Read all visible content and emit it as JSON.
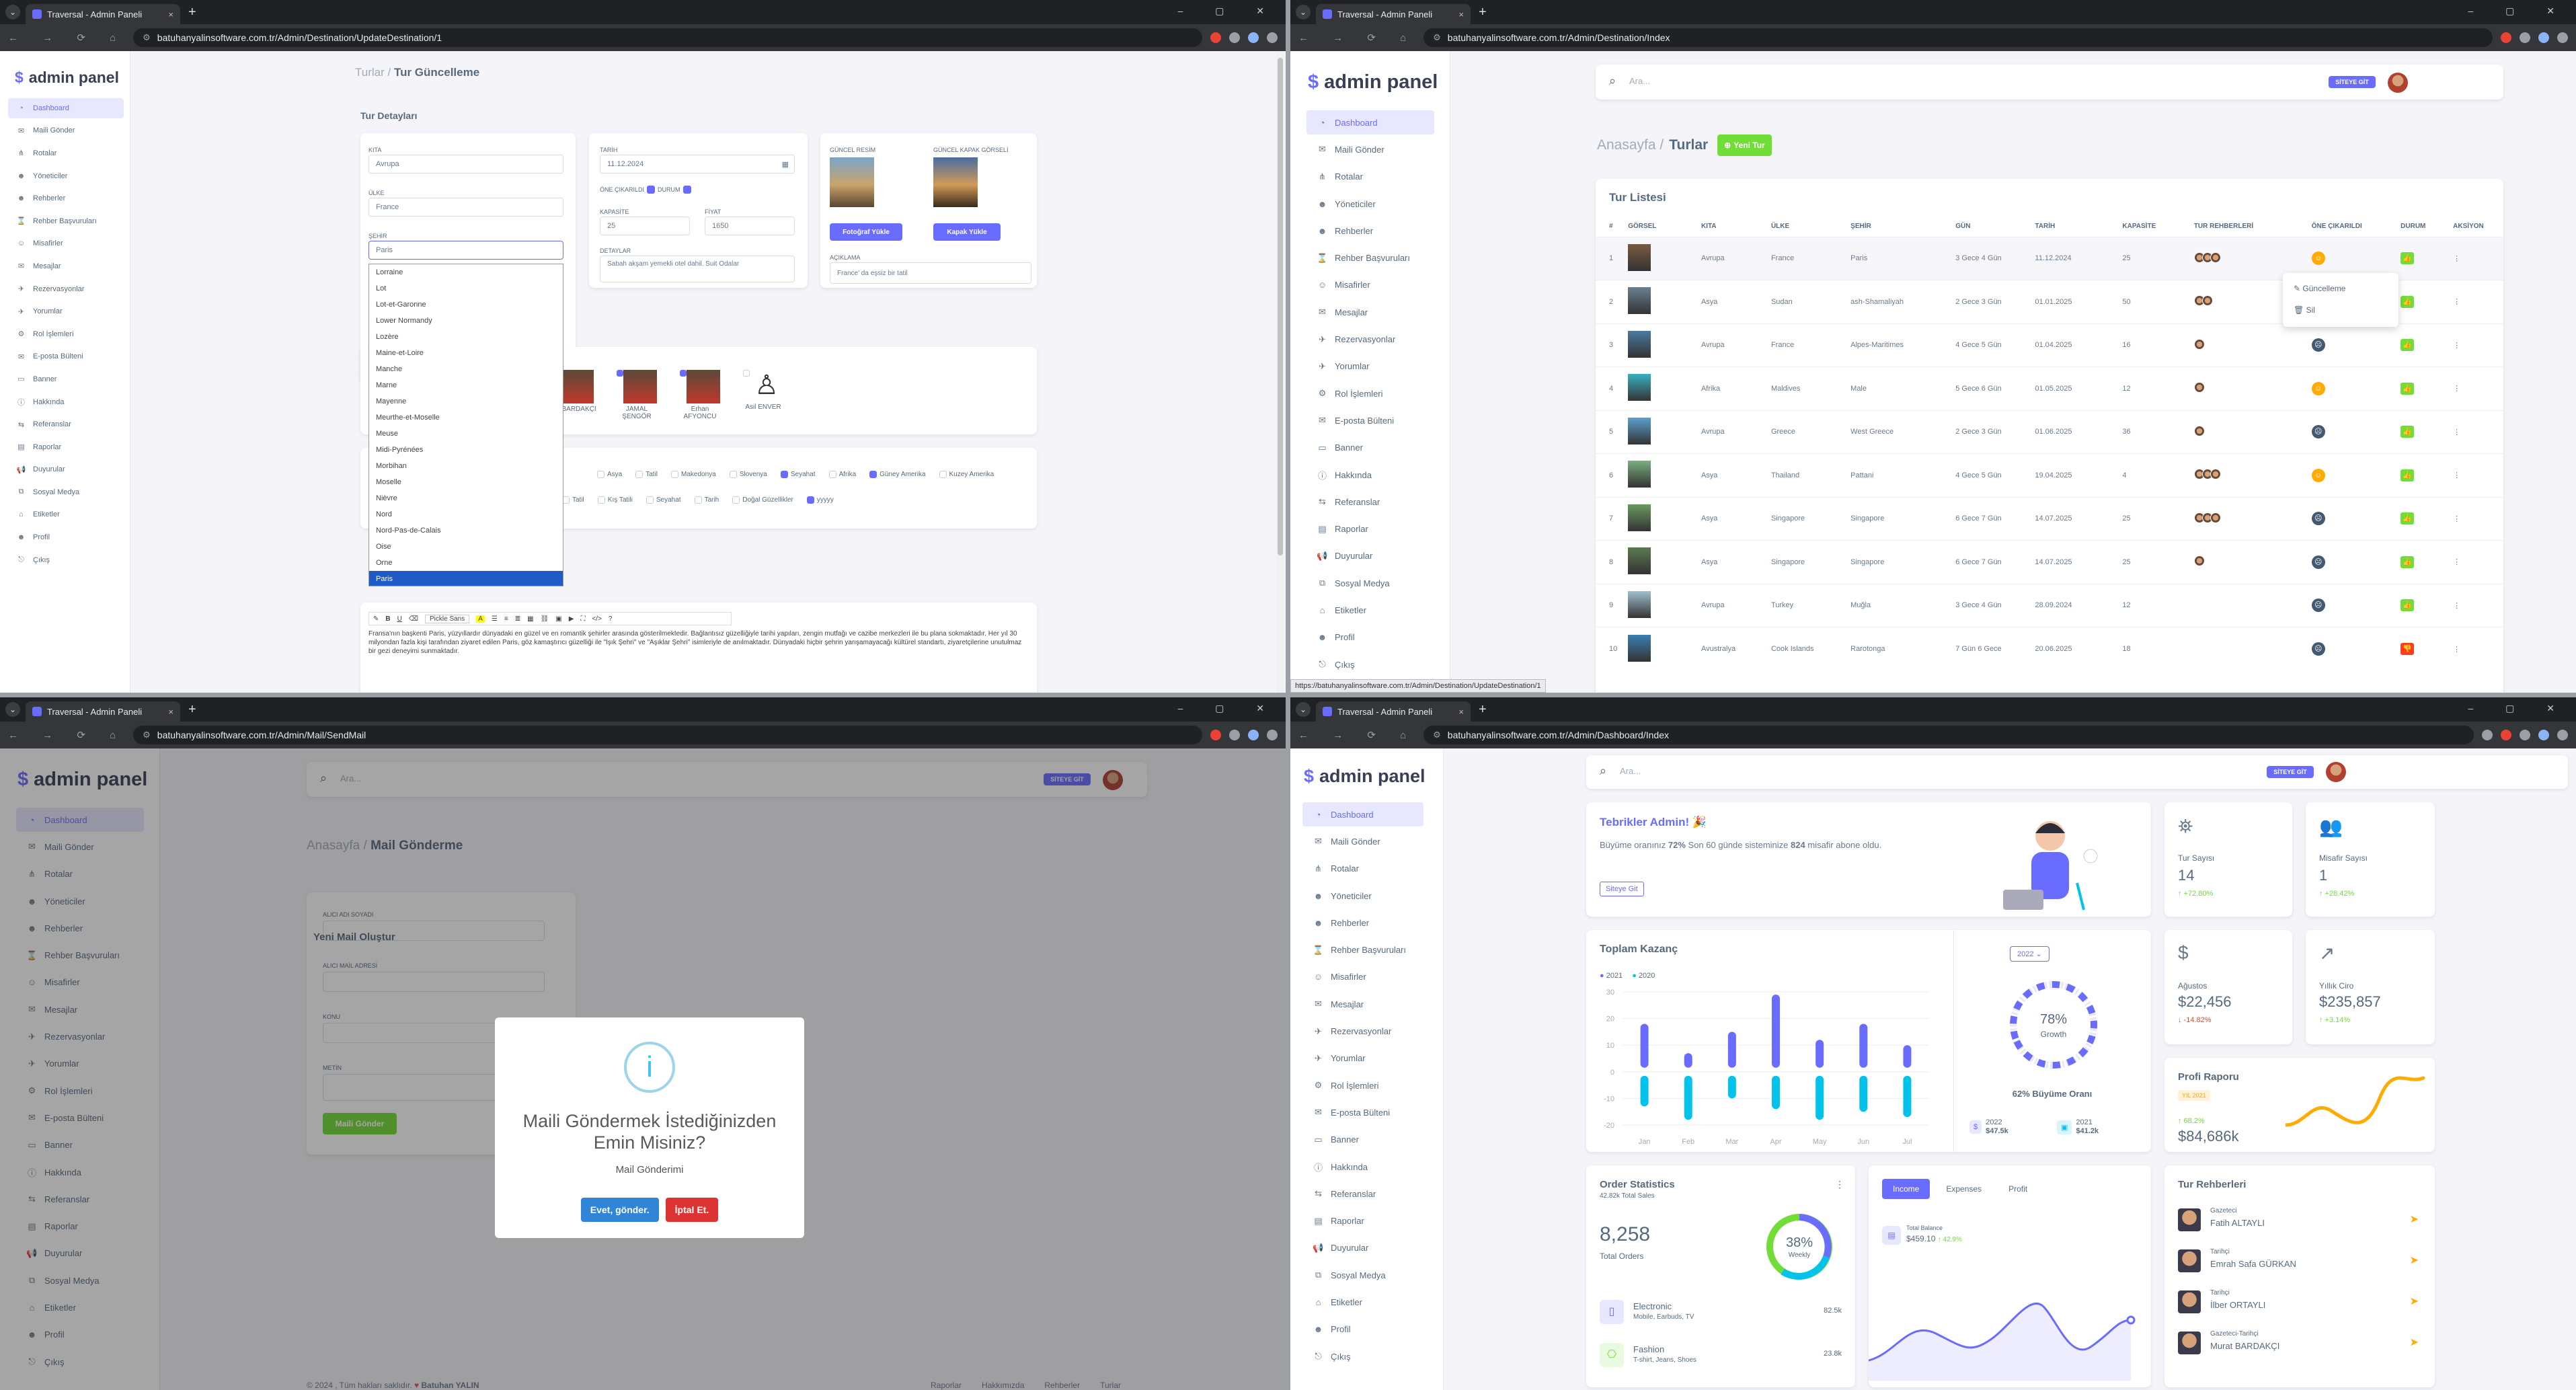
{
  "browser": {
    "tab_title": "Traversal - Admin Paneli",
    "close": "×",
    "new_tab": "+",
    "dropdown": "⌄",
    "controls": "– ▢ ✕",
    "nav": "← → ⟳ ⌂"
  },
  "brand": "admin panel",
  "menu": [
    "Dashboard",
    "Maili Gönder",
    "Rotalar",
    "Yöneticiler",
    "Rehberler",
    "Rehber Başvuruları",
    "Misafirler",
    "Mesajlar",
    "Rezervasyonlar",
    "Yorumlar",
    "Rol İşlemleri",
    "E-posta Bülteni",
    "Banner",
    "Hakkında",
    "Referanslar",
    "Raporlar",
    "Duyurular",
    "Sosyal Medya",
    "Etiketler",
    "Profil",
    "Çıkış"
  ],
  "menu_icons": [
    "◔",
    "✉",
    "⋔",
    "☻",
    "☻",
    "⌛",
    "☺",
    "✉",
    "✈",
    "✈",
    "⚙",
    "✉",
    "▭",
    "ⓘ",
    "⇆",
    "▤",
    "📢",
    "⧉",
    "⌂",
    "☻",
    "⎋"
  ],
  "search_placeholder": "Ara...",
  "site_button": "SİTEYE GİT",
  "w1": {
    "url": "batuhanyalinsoftware.com.tr/Admin/Destination/UpdateDestination/1",
    "breadcrumb_root": "Turlar /",
    "breadcrumb_current": "Tur Güncelleme",
    "section_title": "Tur Detayları",
    "kita_label": "KITA",
    "kita": "Avrupa",
    "ulke_label": "ÜLKE",
    "ulke": "France",
    "sehir_label": "ŞEHİR",
    "sehir": "Paris",
    "tarih_label": "TARİH",
    "tarih": "11.12.2024",
    "one_cikarildi": "ÖNE ÇIKARILDI",
    "durum": "DURUM",
    "kapasite_label": "KAPASİTE",
    "kapasite": "25",
    "fiyat_label": "FİYAT",
    "fiyat": "1650",
    "detaylar_label": "DETAYLAR",
    "detaylar": "Sabah akşam yemekli otel dahil. Suit Odalar",
    "guncel_resim": "GÜNCEL RESİM",
    "kapak_resim": "GÜNCEL KAPAK GÖRSELİ",
    "foto_btn": "Fotoğraf Yükle",
    "kapak_btn": "Kapak Yükle",
    "aciklama_label": "AÇIKLAMA",
    "aciklama": "France' da eşsiz bir tatil",
    "dropdown": [
      "Lorraine",
      "Lot",
      "Lot-et-Garonne",
      "Lower Normandy",
      "Lozère",
      "Maine-et-Loire",
      "Manche",
      "Marne",
      "Mayenne",
      "Meurthe-et-Moselle",
      "Meuse",
      "Midi-Pyrénées",
      "Morbihan",
      "Moselle",
      "Nièvre",
      "Nord",
      "Nord-Pas-de-Calais",
      "Oise",
      "Orne",
      "Paris"
    ],
    "guides": [
      {
        "name": "cat BARDAKÇI"
      },
      {
        "name": "JAMAL ŞENGÖR"
      },
      {
        "name": "Erhan AFYONCU"
      },
      {
        "name": "Asil ENVER"
      }
    ],
    "tags1": [
      "Asya",
      "Tatil",
      "Makedonya",
      "Slovenya",
      "Seyahat",
      "Afrika",
      "Güney Amerika",
      "Kuzey Amerika"
    ],
    "tags2": [
      "Tatil",
      "Kış Tatili",
      "Seyahat",
      "Tarih",
      "Doğal Güzellikler",
      "yyyyy"
    ],
    "editor_font": "Pickle Sans",
    "editor_text": "Fransa'nın başkenti Paris, yüzyıllardır dünyadaki en güzel ve en romantik şehirler arasında gösterilmektedir. Bağlantısız güzelliğiyle tarihi yapıları, zengin mutfağı ve cazibe merkezleri ile bu plana sokmaktadır. Her yıl 30 milyondan fazla kişi tarafından ziyaret edilen Paris, göz kamaştırıcı güzelliği ile \"Işık Şehri\" ve \"Aşıklar Şehri\" isimleriyle de anılmaktadır. Dünyadaki hiçbir şehrin yarışamayacağı kültürel standartı, ziyaretçilerine unutulmaz bir gezi deneyimi sunmaktadır."
  },
  "w2": {
    "url": "batuhanyalinsoftware.com.tr/Admin/Destination/Index",
    "breadcrumb_root": "Anasayfa /",
    "breadcrumb_current": "Turlar",
    "new_btn": "Yeni Tur",
    "list_title": "Tur Listesi",
    "headers": [
      "#",
      "GÖRSEL",
      "KITA",
      "ÜLKE",
      "ŞEHİR",
      "GÜN",
      "TARİH",
      "KAPASİTE",
      "TUR REHBERLERİ",
      "ÖNE ÇIKARILDI",
      "DURUM",
      "AKSİYON"
    ],
    "rows": [
      [
        "1",
        "Avrupa",
        "France",
        "Paris",
        "3 Gece 4 Gün",
        "11.12.2024",
        "25",
        "3",
        "y",
        "on"
      ],
      [
        "2",
        "Asya",
        "Sudan",
        "ash-Shamaliyah",
        "2 Gece 3 Gün",
        "01.01.2025",
        "50",
        "2",
        "y",
        "on"
      ],
      [
        "3",
        "Avrupa",
        "France",
        "Alpes-Maritimes",
        "4 Gece 5 Gün",
        "01.04.2025",
        "16",
        "1",
        "n",
        "on"
      ],
      [
        "4",
        "Afrika",
        "Maldives",
        "Male",
        "5 Gece 6 Gün",
        "01.05.2025",
        "12",
        "1",
        "y",
        "on"
      ],
      [
        "5",
        "Avrupa",
        "Greece",
        "West Greece",
        "2 Gece 3 Gün",
        "01.06.2025",
        "36",
        "1",
        "n",
        "on"
      ],
      [
        "6",
        "Asya",
        "Thailand",
        "Pattani",
        "4 Gece 5 Gün",
        "19.04.2025",
        "4",
        "3",
        "y",
        "on"
      ],
      [
        "7",
        "Asya",
        "Singapore",
        "Singapore",
        "6 Gece 7 Gün",
        "14.07.2025",
        "25",
        "3",
        "n",
        "on"
      ],
      [
        "8",
        "Asya",
        "Singapore",
        "Singapore",
        "6 Gece 7 Gün",
        "14.07.2025",
        "25",
        "1",
        "n",
        "on"
      ],
      [
        "9",
        "Avrupa",
        "Turkey",
        "Muğla",
        "3 Gece 4 Gün",
        "28.09.2024",
        "12",
        "0",
        "n",
        "on"
      ],
      [
        "10",
        "Avustralya",
        "Cook Islands",
        "Rarotonga",
        "7 Gün 6 Gece",
        "20.06.2025",
        "18",
        "0",
        "n",
        "off"
      ]
    ],
    "action_update": "Güncelleme",
    "action_delete": "Sil",
    "status_bar": "https://batuhanyalinsoftware.com.tr/Admin/Destination/UpdateDestination/1"
  },
  "w3": {
    "url": "batuhanyalinsoftware.com.tr/Admin/Mail/SendMail",
    "breadcrumb_root": "Anasayfa /",
    "breadcrumb_current": "Mail Gönderme",
    "form_title": "Yeni Mail Oluştur",
    "f1": "ALICI ADI SOYADI",
    "f2": "ALICI MAİL ADRESİ",
    "f3": "KONU",
    "f4": "METİN",
    "send_btn": "Maili Gönder",
    "modal_title": "Maili Göndermek İstediğinizden Emin Misiniz?",
    "modal_text": "Mail Gönderimi",
    "confirm": "Evet, gönder.",
    "cancel": "İptal Et.",
    "footer_left": "© 2024 , Tüm hakları saklıdır.",
    "footer_author": "Batuhan YALIN",
    "footer_links": [
      "Raporlar",
      "Hakkımızda",
      "Rehberler",
      "Turlar"
    ]
  },
  "w4": {
    "url": "batuhanyalinsoftware.com.tr/Admin/Dashboard/Index",
    "congrats": "Tebrikler Admin! 🎉",
    "congrats_text_1": "Büyüme oranınız ",
    "congrats_rate": "72%",
    "congrats_text_2": " Son 60 günde sisteminize ",
    "congrats_count": "824",
    "congrats_text_3": " misafir abone oldu.",
    "site_btn": "Siteye Git",
    "tur_label": "Tur Sayısı",
    "tur_value": "14",
    "tur_delta": "↑ +72.80%",
    "misafir_label": "Misafir Sayısı",
    "misafir_value": "1",
    "misafir_delta": "↑ +28.42%",
    "earn_title": "Toplam Kazanç",
    "legend": [
      "2021",
      "2020"
    ],
    "year_btn": "2022 ⌄",
    "growth_pct": "78%",
    "growth_label": "Growth",
    "growth_caption": "62% Büyüme Oranı",
    "y2022": "2022",
    "v2022": "$47.5k",
    "y2021": "2021",
    "v2021": "$41.2k",
    "agustos_label": "Ağustos",
    "agustos_value": "$22,456",
    "agustos_delta": "↓ -14.82%",
    "yillik_label": "Yıllık Ciro",
    "yillik_value": "$235,857",
    "yillik_delta": "↑ +3.14%",
    "profi_title": "Profi Raporu",
    "profi_year": "YIL 2021",
    "profi_delta": "↑ 68.2%",
    "profi_value": "$84,686k",
    "order_title": "Order Statistics",
    "order_sub": "42.82k Total Sales",
    "order_value": "8,258",
    "order_label": "Total Orders",
    "weekly_pct": "38%",
    "weekly_label": "Weekly",
    "electronic": "Electronic",
    "electronic_sub": "Mobile, Earbuds, TV",
    "electronic_val": "82.5k",
    "fashion": "Fashion",
    "fashion_sub": "T-shirt, Jeans, Shoes",
    "fashion_val": "23.8k",
    "tabs": [
      "Income",
      "Expenses",
      "Profit"
    ],
    "tb_label": "Total Balance",
    "tb_value": "$459.10",
    "tb_delta": "↑ 42.9%",
    "guides_title": "Tur Rehberleri",
    "guides": [
      {
        "role": "Gazeteci",
        "name": "Fatih ALTAYLI"
      },
      {
        "role": "Tarihçi",
        "name": "Emrah Safa GÜRKAN"
      },
      {
        "role": "Tarihçi",
        "name": "İlber ORTAYLI"
      },
      {
        "role": "Gazeteci-Tarihçi",
        "name": "Murat BARDAKÇI"
      }
    ]
  },
  "chart_data": {
    "type": "bar",
    "title": "Toplam Kazanç",
    "categories": [
      "Jan",
      "Feb",
      "Mar",
      "Apr",
      "May",
      "Jun",
      "Jul"
    ],
    "series": [
      {
        "name": "2021",
        "values": [
          18,
          7,
          15,
          29,
          12,
          18,
          10
        ]
      },
      {
        "name": "2020",
        "values": [
          -13,
          -18,
          -10,
          -14,
          -18,
          -15,
          -17
        ]
      }
    ],
    "ylim": [
      -20,
      30
    ],
    "yticks": [
      30,
      20,
      10,
      0,
      -10,
      -20
    ],
    "colors": {
      "2021": "#696cff",
      "2020": "#03c3ec"
    }
  }
}
